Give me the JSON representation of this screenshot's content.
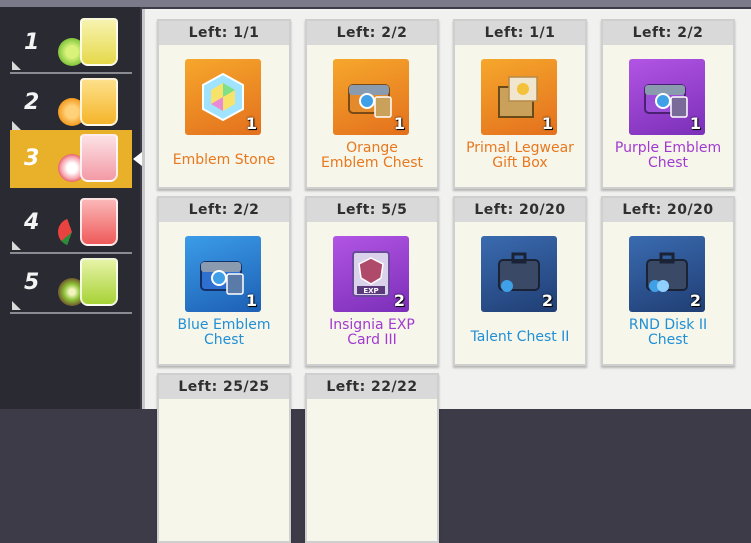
{
  "sidebar": {
    "tiers": [
      {
        "num": "1",
        "fruit": "lime"
      },
      {
        "num": "2",
        "fruit": "orange"
      },
      {
        "num": "3",
        "fruit": "lychee",
        "active": true
      },
      {
        "num": "4",
        "fruit": "watermelon"
      },
      {
        "num": "5",
        "fruit": "kiwi"
      }
    ]
  },
  "items": [
    {
      "left": "Left:  1/1",
      "qty": "1",
      "name1": "Emblem Stone",
      "name2": "",
      "icon": "gem-icon",
      "color": "#e8781e"
    },
    {
      "left": "Left:  2/2",
      "qty": "1",
      "name1": "Orange",
      "name2": "Emblem Chest",
      "icon": "chest-icon",
      "color": "#e8781e"
    },
    {
      "left": "Left:  1/1",
      "qty": "1",
      "name1": "Primal Legwear",
      "name2": "Gift Box",
      "icon": "gift-box-icon",
      "color": "#e8781e"
    },
    {
      "left": "Left:  2/2",
      "qty": "1",
      "name1": "Purple Emblem",
      "name2": "Chest",
      "icon": "chest-icon",
      "color": "#a23ad0"
    },
    {
      "left": "Left:  2/2",
      "qty": "1",
      "name1": "Blue Emblem",
      "name2": "Chest",
      "icon": "chest-icon",
      "color": "#1f8fd6"
    },
    {
      "left": "Left:  5/5",
      "qty": "2",
      "name1": "Insignia EXP",
      "name2": "Card III",
      "icon": "exp-card-icon",
      "color": "#a23ad0",
      "badge": "EXP"
    },
    {
      "left": "Left: 20/20",
      "qty": "2",
      "name1": "Talent Chest II",
      "name2": "",
      "icon": "case-icon",
      "color": "#1f8fd6"
    },
    {
      "left": "Left: 20/20",
      "qty": "2",
      "name1": "RND Disk II",
      "name2": "Chest",
      "icon": "case-icon",
      "color": "#1f8fd6"
    },
    {
      "left": "Left: 25/25"
    },
    {
      "left": "Left: 22/22"
    }
  ]
}
